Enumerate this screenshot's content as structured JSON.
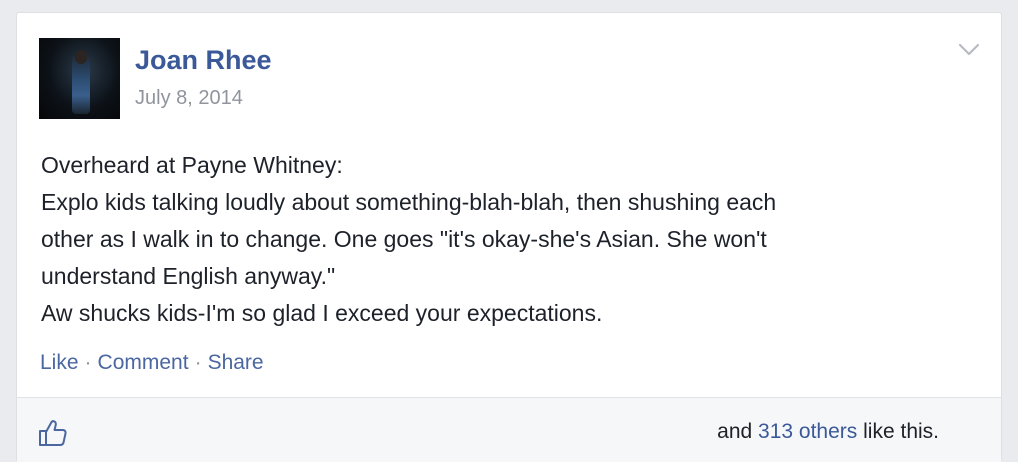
{
  "post": {
    "author": "Joan Rhee",
    "date": "July 8, 2014",
    "text_lines": [
      "Overheard at Payne Whitney:",
      "Explo kids talking loudly about something-blah-blah, then shushing each",
      "other as I walk in to change. One goes \"it's okay-she's Asian. She won't",
      "understand English anyway.\"",
      "Aw shucks kids-I'm so glad I exceed your expectations."
    ]
  },
  "actions": {
    "like": "Like",
    "comment": "Comment",
    "share": "Share",
    "separator": "·"
  },
  "likes": {
    "prefix": "and",
    "others_link": "313 others",
    "suffix": "like this."
  },
  "icons": {
    "menu": "chevron-down-icon",
    "like": "thumbs-up-icon"
  },
  "colors": {
    "link": "#3b5998",
    "muted": "#90949c",
    "text": "#1d2129",
    "background": "#e9ebee",
    "card": "#ffffff"
  }
}
